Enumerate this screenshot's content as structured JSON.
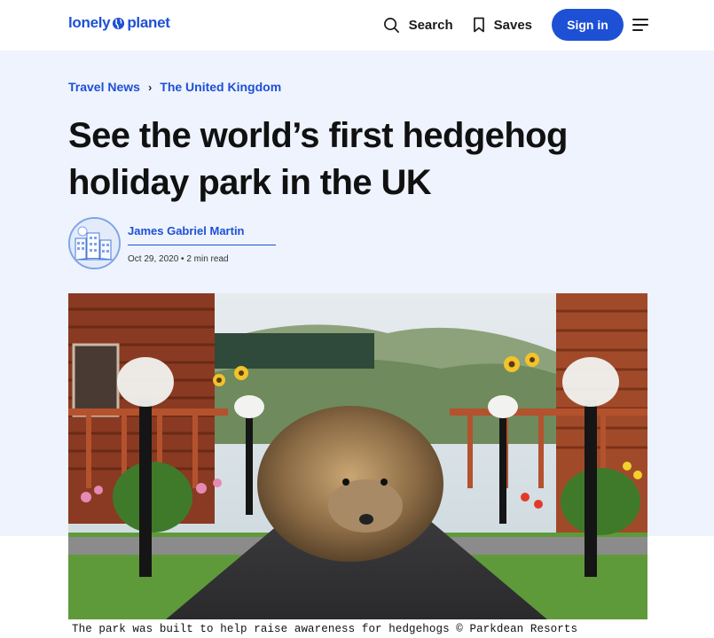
{
  "header": {
    "logo": {
      "word1": "lonely",
      "word2": "planet"
    },
    "search_label": "Search",
    "saves_label": "Saves",
    "signin_label": "Sign in"
  },
  "breadcrumb": [
    "Travel News",
    "The United Kingdom"
  ],
  "article": {
    "title": "See the world’s first hedgehog holiday park in the UK",
    "author_name": "James Gabriel Martin",
    "meta": "Oct 29, 2020 • 2 min read",
    "caption": "The park was built to help raise awareness for hedgehogs © Parkdean Resorts"
  },
  "colors": {
    "brand_blue": "#1e50d6",
    "hero_background": "#eef3fd",
    "title_text": "#111111"
  },
  "icons": [
    "globe-icon",
    "search-icon",
    "bookmark-icon",
    "hamburger-menu-icon"
  ]
}
